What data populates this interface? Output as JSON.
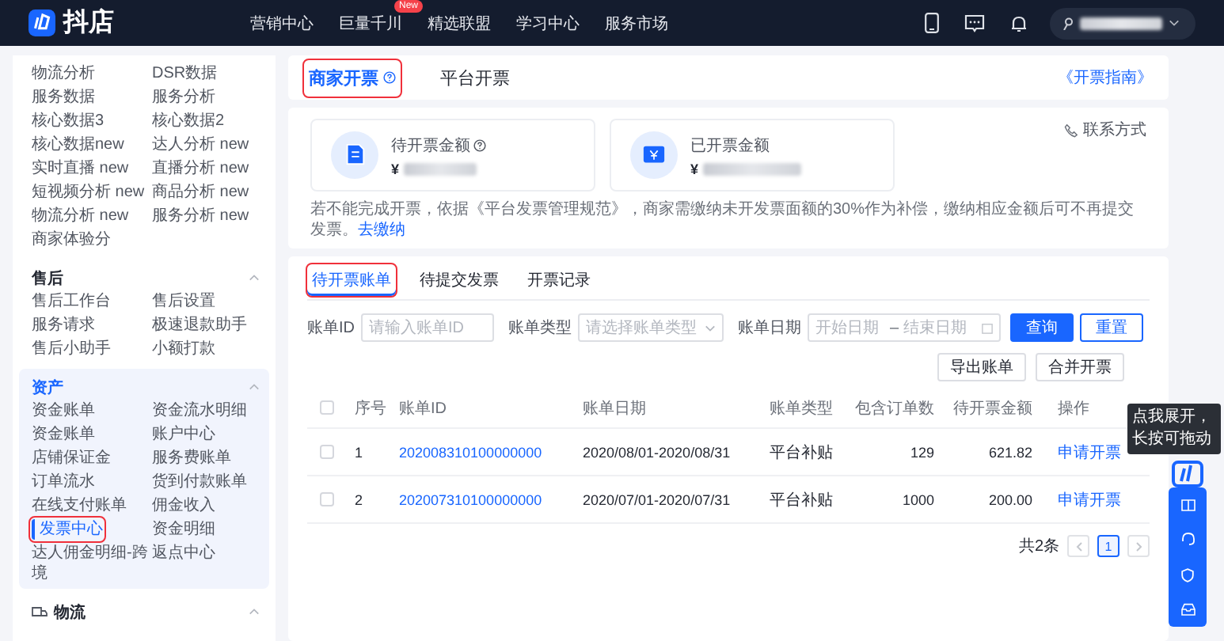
{
  "header": {
    "logo": "抖店",
    "nav": [
      {
        "label": "营销中心"
      },
      {
        "label": "巨量千川",
        "badge": "New"
      },
      {
        "label": "精选联盟"
      },
      {
        "label": "学习中心"
      },
      {
        "label": "服务市场"
      }
    ]
  },
  "sidebar": {
    "groups": [
      {
        "kind": "plain",
        "expanded": true,
        "selected": false,
        "items": [
          {
            "label": "物流分析",
            "selected": false,
            "highlighted": false
          },
          {
            "label": "DSR数据",
            "selected": false,
            "highlighted": false
          },
          {
            "label": "服务数据",
            "selected": false,
            "highlighted": false
          },
          {
            "label": "服务分析",
            "selected": false,
            "highlighted": false
          },
          {
            "label": "核心数据3",
            "selected": false,
            "highlighted": false
          },
          {
            "label": "核心数据2",
            "selected": false,
            "highlighted": false
          },
          {
            "label": "核心数据new",
            "selected": false,
            "highlighted": false
          },
          {
            "label": "达人分析 new",
            "selected": false,
            "highlighted": false
          },
          {
            "label": "实时直播 new",
            "selected": false,
            "highlighted": false
          },
          {
            "label": "直播分析 new",
            "selected": false,
            "highlighted": false
          },
          {
            "label": "短视频分析 new",
            "selected": false,
            "highlighted": false
          },
          {
            "label": "商品分析 new",
            "selected": false,
            "highlighted": false
          },
          {
            "label": "物流分析 new",
            "selected": false,
            "highlighted": false
          },
          {
            "label": "服务分析 new",
            "selected": false,
            "highlighted": false
          },
          {
            "label": "商家体验分",
            "selected": false,
            "highlighted": false
          }
        ]
      },
      {
        "kind": "plain",
        "title": "售后",
        "expanded": true,
        "selected": false,
        "items": [
          {
            "label": "售后工作台",
            "selected": false,
            "highlighted": false
          },
          {
            "label": "售后设置",
            "selected": false,
            "highlighted": false
          },
          {
            "label": "服务请求",
            "selected": false,
            "highlighted": false
          },
          {
            "label": "极速退款助手",
            "selected": false,
            "highlighted": false
          },
          {
            "label": "售后小助手",
            "selected": false,
            "highlighted": false
          },
          {
            "label": "小额打款",
            "selected": false,
            "highlighted": false
          }
        ]
      },
      {
        "kind": "plain",
        "title": "资产",
        "expanded": true,
        "selected": true,
        "items": [
          {
            "label": "资金账单",
            "selected": false,
            "highlighted": false
          },
          {
            "label": "资金流水明细",
            "selected": false,
            "highlighted": false
          },
          {
            "label": "资金账单",
            "selected": false,
            "highlighted": false
          },
          {
            "label": "账户中心",
            "selected": false,
            "highlighted": false
          },
          {
            "label": "店铺保证金",
            "selected": false,
            "highlighted": false
          },
          {
            "label": "服务费账单",
            "selected": false,
            "highlighted": false
          },
          {
            "label": "订单流水",
            "selected": false,
            "highlighted": false
          },
          {
            "label": "货到付款账单",
            "selected": false,
            "highlighted": false
          },
          {
            "label": "在线支付账单",
            "selected": false,
            "highlighted": false
          },
          {
            "label": "佣金收入",
            "selected": false,
            "highlighted": false
          },
          {
            "label": "发票中心",
            "selected": true,
            "highlighted": true
          },
          {
            "label": "资金明细",
            "selected": false,
            "highlighted": false
          },
          {
            "label": "达人佣金明细-跨境",
            "selected": false,
            "highlighted": false
          },
          {
            "label": "返点中心",
            "selected": false,
            "highlighted": false
          }
        ]
      },
      {
        "kind": "icon",
        "title": "物流",
        "expanded": true,
        "selected": false
      }
    ]
  },
  "invoice_tabs": [
    {
      "label": "商家开票",
      "selected": true,
      "highlighted": true,
      "help": true
    },
    {
      "label": "平台开票",
      "selected": false,
      "highlighted": false,
      "help": false
    }
  ],
  "guide_link": "《开票指南》",
  "summary": {
    "cards": [
      {
        "kind": "pending",
        "label": "待开票金额",
        "help": true,
        "currency": "¥"
      },
      {
        "kind": "issued",
        "label": "已开票金额",
        "help": false,
        "currency": "¥"
      }
    ],
    "contact": "联系方式",
    "notice": "若不能完成开票，依据《平台发票管理规范》，商家需缴纳未开发票面额的30%作为补偿，缴纳相应金额后可不再提交发票。",
    "notice_link": "去缴纳"
  },
  "bill_tabs": [
    {
      "label": "待开票账单",
      "selected": true,
      "highlighted": true
    },
    {
      "label": "待提交发票",
      "selected": false,
      "highlighted": false
    },
    {
      "label": "开票记录",
      "selected": false,
      "highlighted": false
    }
  ],
  "filters": [
    {
      "kind": "input",
      "label": "账单ID",
      "placeholder": "请输入账单ID"
    },
    {
      "kind": "select",
      "label": "账单类型",
      "placeholder": "请选择账单类型"
    },
    {
      "kind": "daterange",
      "label": "账单日期",
      "placeholder": "开始日期",
      "separator": "–",
      "placeholder_end": "结束日期"
    }
  ],
  "filter_buttons": [
    {
      "label": "查询",
      "primary": true
    },
    {
      "label": "重置",
      "primary": false
    }
  ],
  "actions": [
    "导出账单",
    "合并开票"
  ],
  "table": {
    "all_checked": false,
    "columns": [
      "序号",
      "账单ID",
      "账单日期",
      "账单类型",
      "包含订单数",
      "待开票金额",
      "操作"
    ],
    "rows": [
      {
        "checked": false,
        "cells": [
          "1",
          "202008310100000000",
          "2020/08/01-2020/08/31",
          "平台补贴",
          "129",
          "621.82"
        ],
        "action": "申请开票"
      },
      {
        "checked": false,
        "cells": [
          "2",
          "202007310100000000",
          "2020/07/01-2020/07/31",
          "平台补贴",
          "1000",
          "200.00"
        ],
        "action": "申请开票"
      }
    ]
  },
  "pagination": {
    "total": "共2条",
    "pages": [
      {
        "label": "1",
        "selected": true
      }
    ]
  },
  "helper": {
    "tooltip": "点我展开，长按可拖动"
  }
}
